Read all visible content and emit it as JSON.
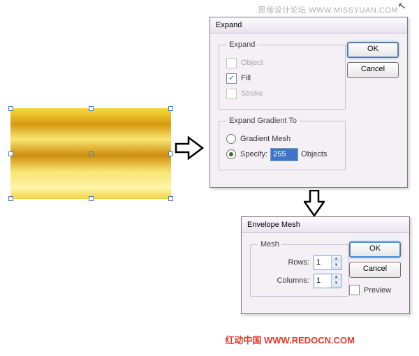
{
  "watermarks": {
    "top": "思缘设计论坛  WWW.MISSYUAN.COM",
    "bottom": "红动中国  WWW.REDOCN.COM"
  },
  "dialog1": {
    "title": "Expand",
    "group_expand": {
      "legend": "Expand",
      "object": "Object",
      "fill": "Fill",
      "stroke": "Stroke"
    },
    "group_gradient": {
      "legend": "Expand Gradient To",
      "mesh": "Gradient Mesh",
      "specify_label": "Specify:",
      "specify_value": "255",
      "specify_suffix": "Objects"
    },
    "buttons": {
      "ok": "OK",
      "cancel": "Cancel"
    }
  },
  "dialog2": {
    "title": "Envelope Mesh",
    "group_mesh": {
      "legend": "Mesh",
      "rows_label": "Rows:",
      "rows_value": "1",
      "cols_label": "Columns:",
      "cols_value": "1"
    },
    "preview": "Preview",
    "buttons": {
      "ok": "OK",
      "cancel": "Cancel"
    }
  }
}
